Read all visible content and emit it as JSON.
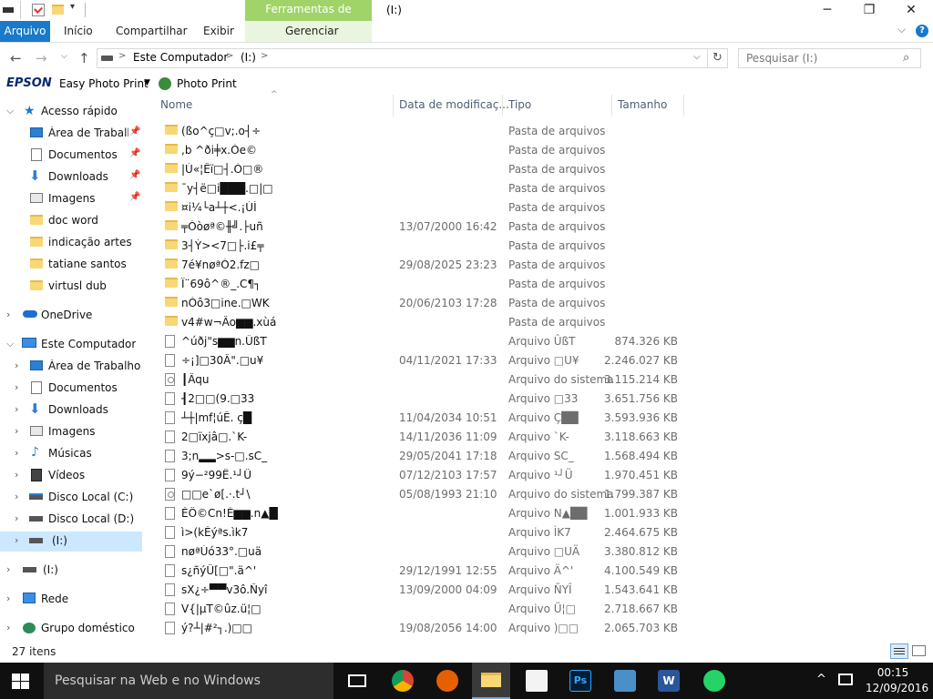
{
  "titlebar": {
    "context_tab": "Ferramentas de Unidade",
    "window_title": "(I:)",
    "minimize": "─",
    "maximize": "❐",
    "close": "✕"
  },
  "ribbon": {
    "file_tab": "Arquivo",
    "tabs": [
      "Início",
      "Compartilhar",
      "Exibir",
      "Gerenciar"
    ],
    "expand": "⌵",
    "help": "?"
  },
  "address": {
    "crumbs": [
      "Este Computador",
      "(I:)"
    ],
    "separator": ">",
    "search_placeholder": "Pesquisar  (I:)"
  },
  "epson": {
    "brand": "EPSON",
    "easy_photo_print": "Easy Photo Print",
    "photo_print": "Photo Print"
  },
  "sidebar": {
    "quick_access": "Acesso rápido",
    "quick_items": [
      {
        "label": "Área de Trabalho",
        "icon": "desktop-icon",
        "pinned": true
      },
      {
        "label": "Documentos",
        "icon": "documents-icon",
        "pinned": true
      },
      {
        "label": "Downloads",
        "icon": "downloads-icon",
        "pinned": true
      },
      {
        "label": "Imagens",
        "icon": "images-icon",
        "pinned": true
      },
      {
        "label": "doc word",
        "icon": "folder-icon",
        "pinned": false
      },
      {
        "label": "indicação artes",
        "icon": "folder-icon",
        "pinned": false
      },
      {
        "label": "tatiane santos",
        "icon": "folder-icon",
        "pinned": false
      },
      {
        "label": "virtusl dub",
        "icon": "folder-icon",
        "pinned": false
      }
    ],
    "onedrive": "OneDrive",
    "this_pc": "Este Computador",
    "pc_items": [
      {
        "label": "Área de Trabalho",
        "icon": "desktop-icon"
      },
      {
        "label": "Documentos",
        "icon": "documents-icon"
      },
      {
        "label": "Downloads",
        "icon": "downloads-icon"
      },
      {
        "label": "Imagens",
        "icon": "images-icon"
      },
      {
        "label": "Músicas",
        "icon": "music-icon"
      },
      {
        "label": "Vídeos",
        "icon": "videos-icon"
      },
      {
        "label": "Disco Local (C:)",
        "icon": "drive-icon"
      },
      {
        "label": "Disco Local (D:)",
        "icon": "drive-icon"
      },
      {
        "label": "(I:)",
        "icon": "drive-icon"
      }
    ],
    "drive_i": "(I:)",
    "network": "Rede",
    "homegroup": "Grupo doméstico"
  },
  "columns": {
    "name": "Nome",
    "date": "Data de modificaç...",
    "type": "Tipo",
    "size": "Tamanho"
  },
  "files": [
    {
      "name": "(ßo^ç□v;.o┤÷",
      "date": "",
      "type": "Pasta de arquivos",
      "size": "",
      "kind": "folder"
    },
    {
      "name": ",b ^ði╪x.Òe©",
      "date": "",
      "type": "Pasta de arquivos",
      "size": "",
      "kind": "folder"
    },
    {
      "name": "|Ú«¦Êï□┤.Ó□®",
      "date": "",
      "type": "Pasta de arquivos",
      "size": "",
      "kind": "folder"
    },
    {
      "name": "¯y┤ë□i███.□|□",
      "date": "",
      "type": "Pasta de arquivos",
      "size": "",
      "kind": "folder"
    },
    {
      "name": "¤i¼└a┴┼<.¡ÚÌ",
      "date": "",
      "type": "Pasta de arquivos",
      "size": "",
      "kind": "folder"
    },
    {
      "name": "╤Òòøª©╫╝.├uñ",
      "date": "13/07/2000 16:42",
      "type": "Pasta de arquivos",
      "size": "",
      "kind": "folder"
    },
    {
      "name": "3┤Ý><7□├.i£╤",
      "date": "",
      "type": "Pasta de arquivos",
      "size": "",
      "kind": "folder"
    },
    {
      "name": "7é¥nøªÒ2.fz□",
      "date": "29/08/2025 23:23",
      "type": "Pasta de arquivos",
      "size": "",
      "kind": "folder"
    },
    {
      "name": "Ï¨69ô^®_.C¶┐",
      "date": "",
      "type": "Pasta de arquivos",
      "size": "",
      "kind": "folder"
    },
    {
      "name": "nÓô3□ine.□WK",
      "date": "20/06/2103 17:28",
      "type": "Pasta de arquivos",
      "size": "",
      "kind": "folder"
    },
    {
      "name": "v4#w¬Âo▆▆.xùá",
      "date": "",
      "type": "Pasta de arquivos",
      "size": "",
      "kind": "folder"
    },
    {
      "name": "^úðj\"s▆▆n.ÛßT",
      "date": "",
      "type": "Arquivo ÛßT",
      "size": "874.326 KB",
      "kind": "file"
    },
    {
      "name": "÷¡]□30Â\".□u¥",
      "date": "04/11/2021 17:33",
      "type": "Arquivo □U¥",
      "size": "2.246.027 KB",
      "kind": "file"
    },
    {
      "name": "┃Âqu",
      "date": "",
      "type": "Arquivo do sistema",
      "size": "3.115.214 KB",
      "kind": "sys"
    },
    {
      "name": "┨2□□(9.□33",
      "date": "",
      "type": "Arquivo □33",
      "size": "3.651.756 KB",
      "kind": "file"
    },
    {
      "name": "┴┼|mf¦úÊ. ç█",
      "date": "11/04/2034 10:51",
      "type": "Arquivo  Ç██",
      "size": "3.593.936 KB",
      "kind": "file"
    },
    {
      "name": "2□ïxjâ□.`K-",
      "date": "14/11/2036 11:09",
      "type": "Arquivo `K-",
      "size": "3.118.663 KB",
      "kind": "file"
    },
    {
      "name": "3;n▂▂>s-□.sC_",
      "date": "29/05/2041 17:18",
      "type": "Arquivo SC_",
      "size": "1.568.494 KB",
      "kind": "file"
    },
    {
      "name": "9ý−²99Ë.¹┘Ü",
      "date": "07/12/2103 17:57",
      "type": "Arquivo ¹┘Ü",
      "size": "1.970.451 KB",
      "kind": "file"
    },
    {
      "name": "□□e`ø[.·.t┘\\",
      "date": "05/08/1993 21:10",
      "type": "Arquivo do sistema",
      "size": "1.799.387 KB",
      "kind": "sys"
    },
    {
      "name": "ÉÖ©Cn!È▆▆.n▲█",
      "date": "",
      "type": "Arquivo N▲██",
      "size": "1.001.933 KB",
      "kind": "file"
    },
    {
      "name": "ì>(kÉýªs.ìk7",
      "date": "",
      "type": "Arquivo ÌK7",
      "size": "2.464.675 KB",
      "kind": "file"
    },
    {
      "name": "nøªÚó33°.□uä",
      "date": "",
      "type": "Arquivo □UÄ",
      "size": "3.380.812 KB",
      "kind": "file"
    },
    {
      "name": "s¿ñýÜ[□\".ä^'",
      "date": "29/12/1991 12:55",
      "type": "Arquivo Ä^'",
      "size": "4.100.549 KB",
      "kind": "file"
    },
    {
      "name": "sX¿÷▀▀v3ô.Ñyî",
      "date": "13/09/2000 04:09",
      "type": "Arquivo ÑYÎ",
      "size": "1.543.641 KB",
      "kind": "file"
    },
    {
      "name": "V{|µT©ûz.ü¦□",
      "date": "",
      "type": "Arquivo Ü¦□",
      "size": "2.718.667 KB",
      "kind": "file"
    },
    {
      "name": "ý?┴|#²┐.)□□",
      "date": "19/08/2056 14:00",
      "type": "Arquivo )□□",
      "size": "2.065.703 KB",
      "kind": "file"
    }
  ],
  "status": {
    "count": "27 itens"
  },
  "taskbar": {
    "search_placeholder": "Pesquisar na Web e no Windows",
    "time": "00:15",
    "date": "12/09/2016"
  },
  "colors": {
    "accent": "#1979ca",
    "context_tab": "#a0d468",
    "taskbar": "#101010",
    "selected": "#cce8ff"
  }
}
